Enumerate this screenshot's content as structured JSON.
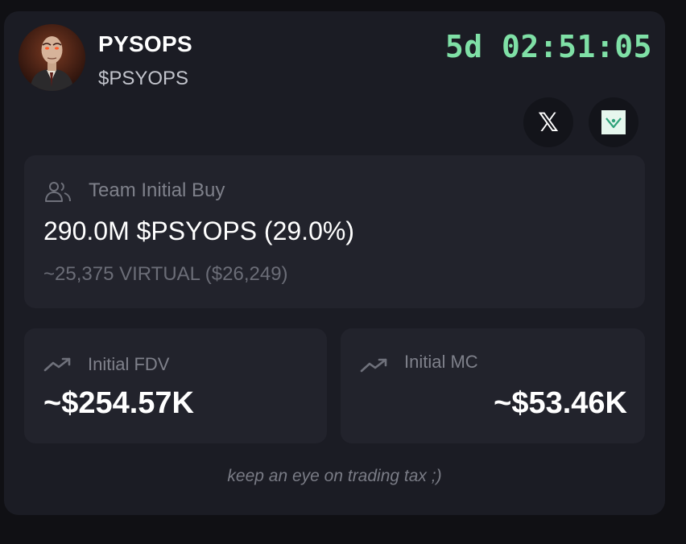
{
  "token": {
    "name": "PYSOPS",
    "ticker": "$PSYOPS",
    "countdown": "5d 02:51:05"
  },
  "links": {
    "x_icon": "x-logo",
    "virtual_icon": "virtuals-logo"
  },
  "team_buy": {
    "label": "Team Initial Buy",
    "amount": "290.0M $PSYOPS (29.0%)",
    "equivalent": "~25,375 VIRTUAL ($26,249)"
  },
  "initial_fdv": {
    "label": "Initial FDV",
    "value": "~$254.57K"
  },
  "initial_mc": {
    "label": "Initial MC",
    "value": "~$53.46K"
  },
  "footnote": "keep an eye on trading tax ;)",
  "colors": {
    "background": "#101014",
    "card": "#1b1c24",
    "panel": "#22232c",
    "countdown": "#7fe0a6",
    "muted_text": "#7f818b"
  }
}
